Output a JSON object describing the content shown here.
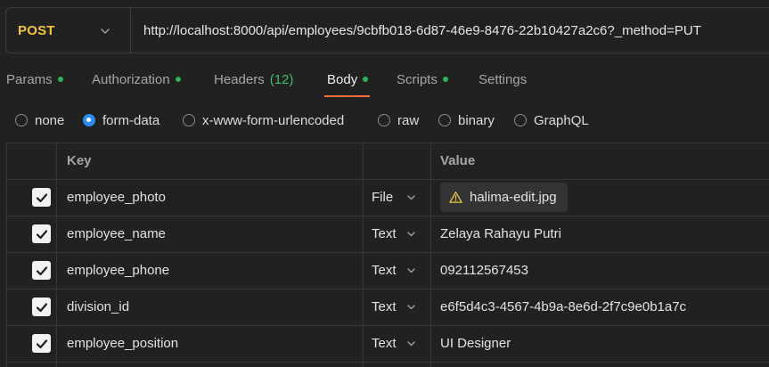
{
  "request": {
    "method": "POST",
    "url": "http://localhost:8000/api/employees/9cbfb018-6d87-46e9-8476-22b10427a2c6?_method=PUT",
    "method_color": "#f1c53d"
  },
  "tabs": [
    {
      "label": "Params",
      "dot": true
    },
    {
      "label": "Authorization",
      "dot": true
    },
    {
      "label": "Headers",
      "count": "(12)"
    },
    {
      "label": "Body",
      "dot": true,
      "active": true
    },
    {
      "label": "Scripts",
      "dot": true
    },
    {
      "label": "Settings"
    }
  ],
  "body_types": [
    {
      "label": "none",
      "checked": false
    },
    {
      "label": "form-data",
      "checked": true
    },
    {
      "label": "x-www-form-urlencoded",
      "checked": false
    },
    {
      "label": "raw",
      "checked": false
    },
    {
      "label": "binary",
      "checked": false
    },
    {
      "label": "GraphQL",
      "checked": false
    }
  ],
  "table": {
    "columns": {
      "key": "Key",
      "value": "Value"
    },
    "rows": [
      {
        "checked": true,
        "key": "employee_photo",
        "type": "File",
        "value": "halima-edit.jpg",
        "value_icon": "warning-icon"
      },
      {
        "checked": true,
        "key": "employee_name",
        "type": "Text",
        "value": "Zelaya Rahayu Putri"
      },
      {
        "checked": true,
        "key": "employee_phone",
        "type": "Text",
        "value": "092112567453"
      },
      {
        "checked": true,
        "key": "division_id",
        "type": "Text",
        "value": "e6f5d4c3-4567-4b9a-8e6d-2f7c9e0b1a7c"
      },
      {
        "checked": true,
        "key": "employee_position",
        "type": "Text",
        "value": "UI Designer"
      }
    ]
  },
  "colors": {
    "accent_underline": "#ff6c37",
    "tab_dot": "#2fb35a",
    "headers_count": "#3fbf6b",
    "radio_selected": "#2d8cf0"
  }
}
